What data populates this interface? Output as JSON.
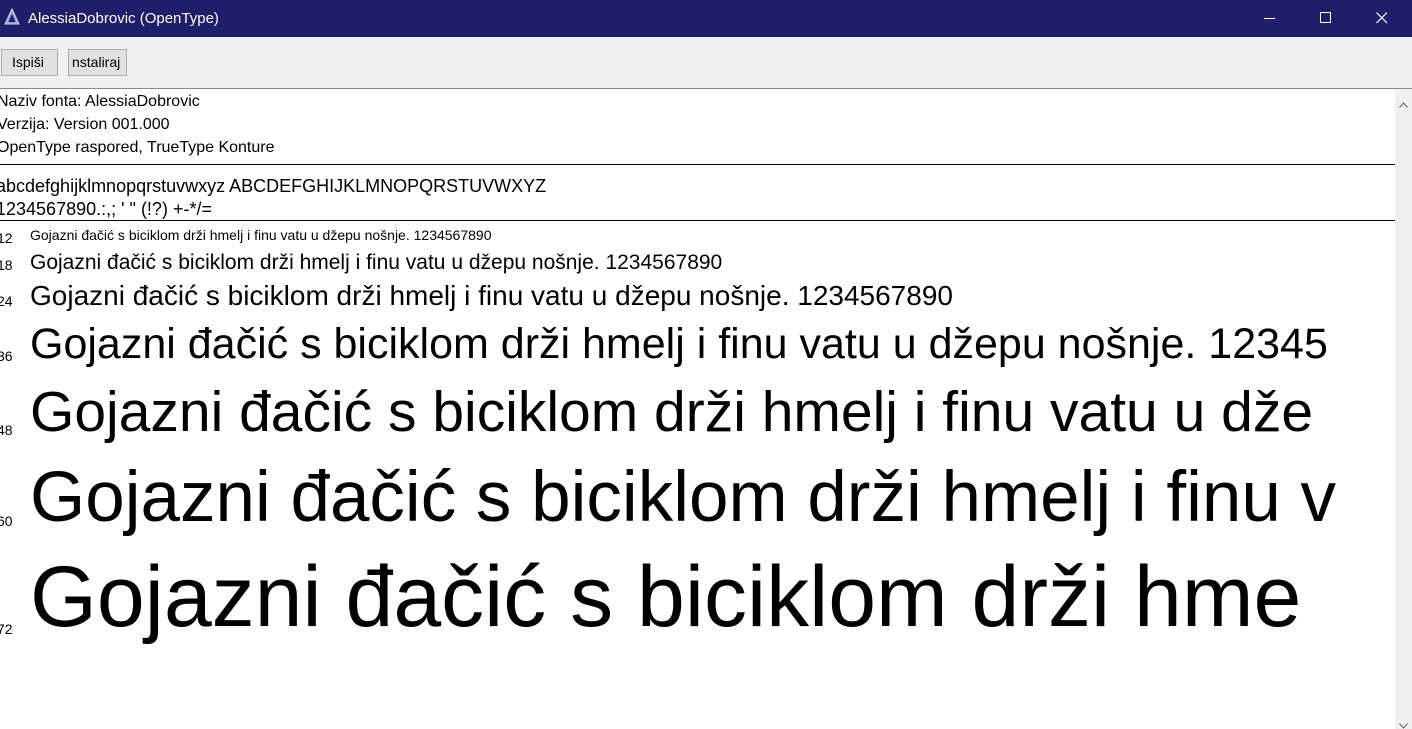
{
  "window": {
    "title": "AlessiaDobrovic (OpenType)",
    "titlebar_color": "#201e6a"
  },
  "toolbar": {
    "print_label": "Ispiši",
    "install_label": "nstaliraj"
  },
  "info": {
    "font_name": "Naziv fonta: AlessiaDobrovic",
    "version": "Verzija: Version 001.000",
    "type": "OpenType raspored, TrueType Konture"
  },
  "charset": {
    "letters": "abcdefghijklmnopqrstuvwxyz ABCDEFGHIJKLMNOPQRSTUVWXYZ",
    "digits": "1234567890.:,; ' \" (!?) +-*/="
  },
  "samples": [
    {
      "size": "12",
      "text": "Gojazni đačić s biciklom drži hmelj i finu vatu u džepu nošnje. 1234567890"
    },
    {
      "size": "18",
      "text": "Gojazni đačić s biciklom drži hmelj i finu vatu u džepu nošnje. 1234567890"
    },
    {
      "size": "24",
      "text": "Gojazni đačić s biciklom drži hmelj i finu vatu u džepu nošnje. 1234567890"
    },
    {
      "size": "36",
      "text": "Gojazni đačić s biciklom drži hmelj i finu vatu u džepu nošnje. 12345"
    },
    {
      "size": "48",
      "text": "Gojazni đačić s biciklom drži hmelj i finu vatu u dže"
    },
    {
      "size": "60",
      "text": "Gojazni đačić s biciklom drži hmelj i finu v"
    },
    {
      "size": "72",
      "text": "Gojazni đačić s biciklom drži hme"
    }
  ]
}
